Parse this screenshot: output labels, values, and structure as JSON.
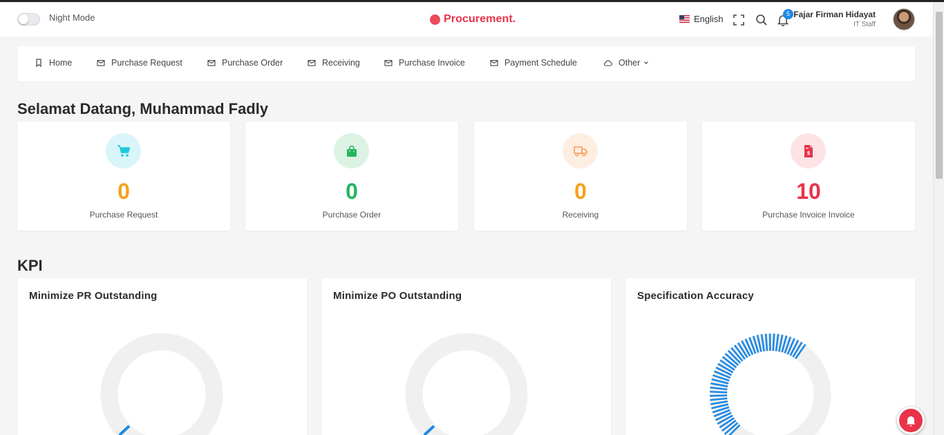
{
  "header": {
    "night_mode_label": "Night Mode",
    "brand": "Procurement.",
    "language": "English",
    "notification_count": "5",
    "user_name": "Fajar Firman Hidayat",
    "user_role": "IT Staff"
  },
  "nav": {
    "items": [
      {
        "label": "Home",
        "icon": "bookmark-icon"
      },
      {
        "label": "Purchase Request",
        "icon": "mail-icon"
      },
      {
        "label": "Purchase Order",
        "icon": "mail-icon"
      },
      {
        "label": "Receiving",
        "icon": "mail-icon"
      },
      {
        "label": "Purchase Invoice",
        "icon": "mail-icon"
      },
      {
        "label": "Payment Schedule",
        "icon": "mail-icon"
      },
      {
        "label": "Other",
        "icon": "cloud-icon"
      }
    ]
  },
  "welcome": "Selamat Datang, Muhammad Fadly",
  "stats": [
    {
      "value": "0",
      "label": "Purchase Request",
      "color": "#f5a21b",
      "icon_bg": "#d9f5f9",
      "icon_color": "#1fc9dd",
      "icon": "cart-icon"
    },
    {
      "value": "0",
      "label": "Purchase Order",
      "color": "#27b45e",
      "icon_bg": "#dcf3e4",
      "icon_color": "#27b45e",
      "icon": "bag-icon"
    },
    {
      "value": "0",
      "label": "Receiving",
      "color": "#f5a21b",
      "icon_bg": "#fdeee2",
      "icon_color": "#f59d5c",
      "icon": "truck-icon"
    },
    {
      "value": "10",
      "label": "Purchase Invoice Invoice",
      "color": "#e8334a",
      "icon_bg": "#fde3e5",
      "icon_color": "#e8334a",
      "icon": "invoice-icon"
    }
  ],
  "kpi": {
    "title": "KPI",
    "cards": [
      {
        "title": "Minimize PR Outstanding"
      },
      {
        "title": "Minimize PO Outstanding"
      },
      {
        "title": "Specification Accuracy"
      }
    ]
  }
}
